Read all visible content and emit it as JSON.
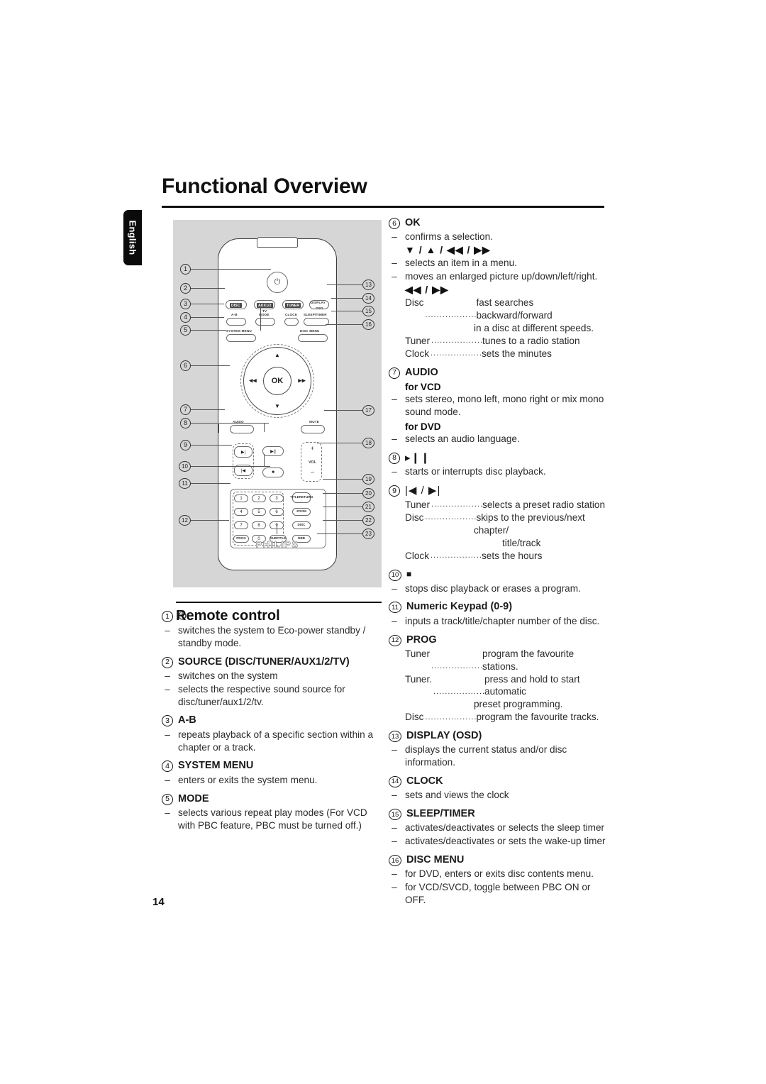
{
  "page": {
    "title": "Functional Overview",
    "language_tab": "English",
    "number": "14"
  },
  "diagram": {
    "section_title": "Remote control",
    "brand": "PHILIPS",
    "ok_label": "OK",
    "buttons": {
      "power": "power-standby",
      "source_disc": "DISC",
      "source_aux": "AUX1/2",
      "source_aux_sub": "TV",
      "source_tuner": "TUNER",
      "display": "DISPLAY",
      "display_sub": "OSD",
      "ab": "A-B",
      "mode": "MODE",
      "clock": "CLOCK",
      "sleeptimer": "SLEEP/TIMER",
      "system_menu": "SYSTEM MENU",
      "disc_menu": "DISC MENU",
      "audio": "AUDIO",
      "mute": "MUTE",
      "vol": "VOL",
      "vol_plus": "+",
      "vol_minus": "–",
      "title_return": "TITLE",
      "title_return2": "RETURN",
      "zoom": "ZOOM",
      "disc": "DISC",
      "dbb": "DBB",
      "prog": "PROG",
      "subtitle": "SUBTITLE",
      "nav_up": "▲",
      "nav_down": "▼",
      "nav_left": "◀◀",
      "nav_right": "▶▶",
      "next": "▶|",
      "prev": "|◀",
      "play_pause": "▶||",
      "stop": "■"
    },
    "keypad": [
      "1",
      "2",
      "3",
      "4",
      "5",
      "6",
      "7",
      "8",
      "9",
      "0"
    ],
    "callouts_left": [
      "1",
      "2",
      "3",
      "4",
      "5",
      "6",
      "7",
      "8",
      "9",
      "10",
      "11",
      "12"
    ],
    "callouts_right": [
      "13",
      "14",
      "15",
      "16",
      "17",
      "18",
      "19",
      "20",
      "21",
      "22",
      "23"
    ]
  },
  "left_column": [
    {
      "num": "1",
      "label": "",
      "glyph": "⏻",
      "bullets": [
        "switches the system to Eco-power standby / standby mode."
      ]
    },
    {
      "num": "2",
      "label": "SOURCE (DISC/TUNER/AUX1/2/TV)",
      "bullets": [
        "switches on the system",
        "selects the respective sound source for disc/tuner/aux1/2/tv."
      ]
    },
    {
      "num": "3",
      "label": "A-B",
      "bullets": [
        "repeats playback of a specific section within a chapter or a track."
      ]
    },
    {
      "num": "4",
      "label": "SYSTEM MENU",
      "bullets": [
        "enters or exits the system menu."
      ]
    },
    {
      "num": "5",
      "label": "MODE",
      "bullets": [
        "selects various repeat play modes (For VCD with PBC feature, PBC must be turned off.)"
      ]
    }
  ],
  "right_column": {
    "e6": {
      "num": "6",
      "label": "OK",
      "b1": "confirms a selection.",
      "arrow_line": "▼ / ▲ / ◀◀ / ▶▶",
      "b2": "selects an item in a menu.",
      "b3": "moves an enlarged picture up/down/left/right.",
      "arrow_line2": "◀◀ / ▶▶",
      "rows": [
        {
          "k": "Disc",
          "v": "fast searches backward/forward",
          "cont": "in a disc at different speeds."
        },
        {
          "k": "Tuner",
          "v": "tunes to a radio station"
        },
        {
          "k": "Clock",
          "v": "sets the minutes"
        }
      ]
    },
    "e7": {
      "num": "7",
      "label": "AUDIO",
      "sub1": "for VCD",
      "b1": "sets stereo, mono left, mono right or mix mono sound mode.",
      "sub2": "for DVD",
      "b2": "selects an audio language."
    },
    "e8": {
      "num": "8",
      "glyph": "▸❙❙",
      "b1": "starts or interrupts disc playback."
    },
    "e9": {
      "num": "9",
      "glyph": "|◀ / ▶|",
      "rows": [
        {
          "k": "Tuner",
          "v": "selects a preset radio station"
        },
        {
          "k": "Disc",
          "v": "skips to the previous/next",
          "cont": "chapter/",
          "cont2": "title/track"
        },
        {
          "k": "Clock",
          "v": "sets the hours"
        }
      ]
    },
    "e10": {
      "num": "10",
      "glyph": "■",
      "b1": "stops disc playback or erases a program."
    },
    "e11": {
      "num": "11",
      "label": "Numeric Keypad (0-9)",
      "b1": "inputs a track/title/chapter number of the disc."
    },
    "e12": {
      "num": "12",
      "label": "PROG",
      "rows": [
        {
          "k": "Tuner",
          "v": "program the favourite stations."
        },
        {
          "k": "Tuner.",
          "v": "press and hold to start automatic",
          "cont": "preset programming."
        },
        {
          "k": "Disc",
          "v": "program the favourite tracks."
        }
      ]
    },
    "e13": {
      "num": "13",
      "label": "DISPLAY (OSD)",
      "b1": "displays the current status and/or disc information."
    },
    "e14": {
      "num": "14",
      "label": "CLOCK",
      "b1": "sets and views the clock"
    },
    "e15": {
      "num": "15",
      "label": "SLEEP/TIMER",
      "b1": "activates/deactivates or selects the sleep timer",
      "b2": "activates/deactivates or sets the wake-up timer"
    },
    "e16": {
      "num": "16",
      "label": "DISC MENU",
      "b1": "for DVD, enters or exits disc contents menu.",
      "b2": "for VCD/SVCD, toggle between PBC ON or OFF."
    }
  },
  "colors": {
    "diagram_bg": "#d6d6d6",
    "tab_bg": "#0b0b0b",
    "text": "#1a1a1a"
  }
}
